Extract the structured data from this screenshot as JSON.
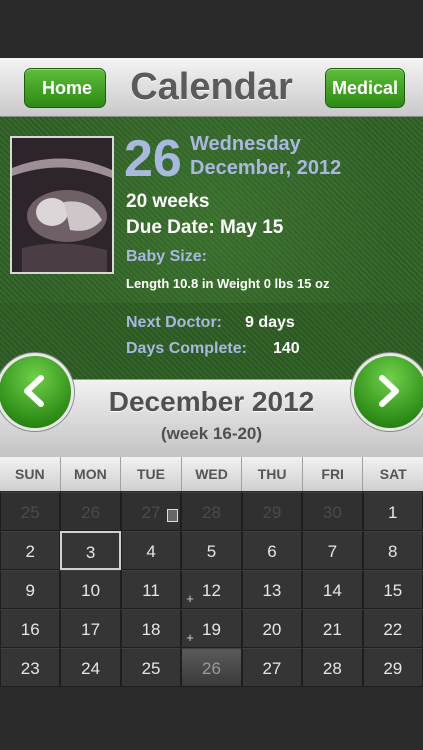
{
  "nav": {
    "title": "Calendar",
    "home_label": "Home",
    "medical_label": "Medical"
  },
  "summary": {
    "day_number": "26",
    "weekday": "Wednesday",
    "month_year": "December, 2012",
    "weeks": "20 weeks",
    "due_date": "Due Date: May 15",
    "baby_size_label": "Baby Size:",
    "measurements": "Length 10.8 in Weight 0 lbs 15 oz",
    "next_doctor_label": "Next Doctor:",
    "next_doctor_value": "9 days",
    "days_complete_label": "Days Complete:",
    "days_complete_value": "140"
  },
  "month": {
    "name": "December 2012",
    "week_range": "(week 16-20)"
  },
  "weekdays": [
    "SUN",
    "MON",
    "TUE",
    "WED",
    "THU",
    "FRI",
    "SAT"
  ],
  "days": [
    {
      "n": "25",
      "other": true
    },
    {
      "n": "26",
      "other": true
    },
    {
      "n": "27",
      "other": true,
      "note": true
    },
    {
      "n": "28",
      "other": true
    },
    {
      "n": "29",
      "other": true
    },
    {
      "n": "30",
      "other": true
    },
    {
      "n": "1"
    },
    {
      "n": "2"
    },
    {
      "n": "3",
      "today": true
    },
    {
      "n": "4"
    },
    {
      "n": "5"
    },
    {
      "n": "6"
    },
    {
      "n": "7"
    },
    {
      "n": "8"
    },
    {
      "n": "9"
    },
    {
      "n": "10"
    },
    {
      "n": "11"
    },
    {
      "n": "12",
      "plus": true
    },
    {
      "n": "13"
    },
    {
      "n": "14"
    },
    {
      "n": "15"
    },
    {
      "n": "16"
    },
    {
      "n": "17"
    },
    {
      "n": "18"
    },
    {
      "n": "19",
      "plus": true
    },
    {
      "n": "20"
    },
    {
      "n": "21"
    },
    {
      "n": "22"
    },
    {
      "n": "23"
    },
    {
      "n": "24"
    },
    {
      "n": "25"
    },
    {
      "n": "26",
      "selected": true
    },
    {
      "n": "27"
    },
    {
      "n": "28"
    },
    {
      "n": "29"
    }
  ],
  "icons": {
    "home_arrow": "chevron-left-icon",
    "prev": "chevron-left-icon",
    "next": "chevron-right-icon",
    "plus": "plus-icon",
    "note": "note-icon"
  }
}
